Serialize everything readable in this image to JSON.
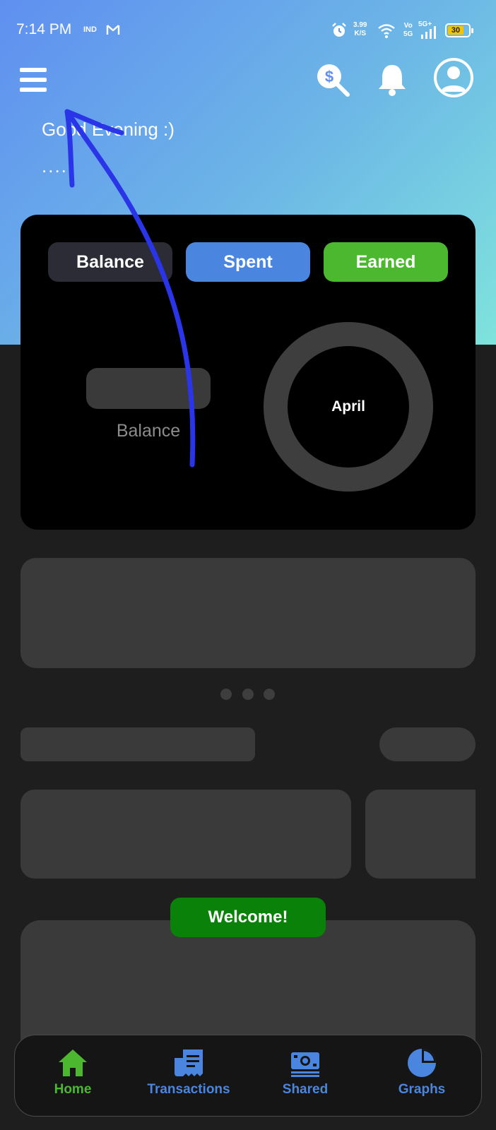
{
  "status_bar": {
    "time": "7:14 PM",
    "carrier": "IND",
    "speed_value": "3.99",
    "speed_unit": "K/S",
    "volte_top": "Vo",
    "volte_bottom": "5G",
    "network": "5G+",
    "battery": "30"
  },
  "header": {
    "greeting": "Good Evening :)",
    "name": "....",
    "icons": [
      "menu-icon",
      "money-search-icon",
      "bell-icon",
      "profile-icon"
    ]
  },
  "summary_card": {
    "tabs": [
      "Balance",
      "Spent",
      "Earned"
    ],
    "amount_label": "Balance",
    "month": "April"
  },
  "toast": {
    "text": "Welcome!"
  },
  "bottom_nav": {
    "items": [
      {
        "label": "Home",
        "icon": "home-icon",
        "color": "#4cb830"
      },
      {
        "label": "Transactions",
        "icon": "receipt-icon",
        "color": "#4a86e0"
      },
      {
        "label": "Shared",
        "icon": "money-icon",
        "color": "#4a86e0"
      },
      {
        "label": "Graphs",
        "icon": "pie-chart-icon",
        "color": "#4a86e0"
      }
    ]
  },
  "colors": {
    "accent_blue": "#4a86e0",
    "accent_green": "#4cb830",
    "toast_green": "#0a820a",
    "annotation": "#2b35e8"
  }
}
